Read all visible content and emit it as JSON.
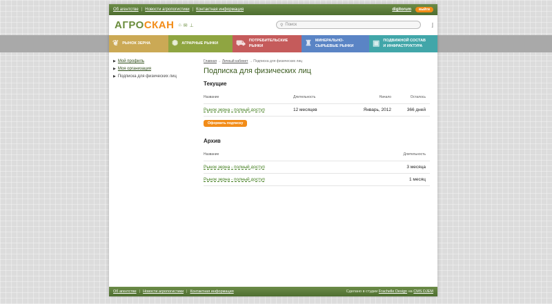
{
  "top_links": [
    "Об агентстве",
    "Новости агропогистики",
    "Контактная информация"
  ],
  "user": "digitorum",
  "logout_label": "выйти",
  "logo": {
    "part1": "АГРО",
    "part2": "СКАН"
  },
  "search": {
    "placeholder": "Поиск"
  },
  "nav": [
    {
      "label1": "Рынок зерна",
      "label2": ""
    },
    {
      "label1": "Аграрные рынки",
      "label2": ""
    },
    {
      "label1": "Потребительские",
      "label2": "рынки"
    },
    {
      "label1": "Минерально-",
      "label2": "сырьевые рынки"
    },
    {
      "label1": "Подвижной состав",
      "label2": "и инфраструктура"
    }
  ],
  "sidebar": {
    "items": [
      {
        "label": "Мой профиль"
      },
      {
        "label": "Моя организация"
      },
      {
        "label": "Подписка для физических лиц"
      }
    ]
  },
  "breadcrumb": {
    "home": "Главная",
    "sep": "→",
    "cabinet": "Личный кабинет",
    "current": "Подписка для физических лиц"
  },
  "page_title": "Подписка для физических лиц",
  "current_section": {
    "title": "Текущие",
    "headers": {
      "name": "Название",
      "duration": "Длительность",
      "start": "Начало",
      "left": "Осталось"
    },
    "rows": [
      {
        "name": "Рынок зерна - полный доступ",
        "duration": "12 месяцев",
        "start": "Январь, 2012",
        "left": "366 дней"
      }
    ],
    "button": "Оформить подписку"
  },
  "archive_section": {
    "title": "Архив",
    "headers": {
      "name": "Название",
      "duration": "Длительность"
    },
    "rows": [
      {
        "name": "Рынок зерна - полный доступ",
        "duration": "3 месяца"
      },
      {
        "name": "Рынок зерна - полный доступ",
        "duration": "1 месяц"
      }
    ]
  },
  "footer": {
    "links": [
      "Об агентстве",
      "Новости агропогистики",
      "Контактная информация"
    ],
    "credit_prefix": "Сделано в студии",
    "studio": "Frachelle Design",
    "credit_mid": "на",
    "cms": "CMS DJEM"
  },
  "colors": {
    "green": "#5a7a3a",
    "orange": "#f28c18",
    "nav": [
      "#cba955",
      "#8fa541",
      "#c55b5b",
      "#5a84c5",
      "#41a6a9"
    ]
  }
}
